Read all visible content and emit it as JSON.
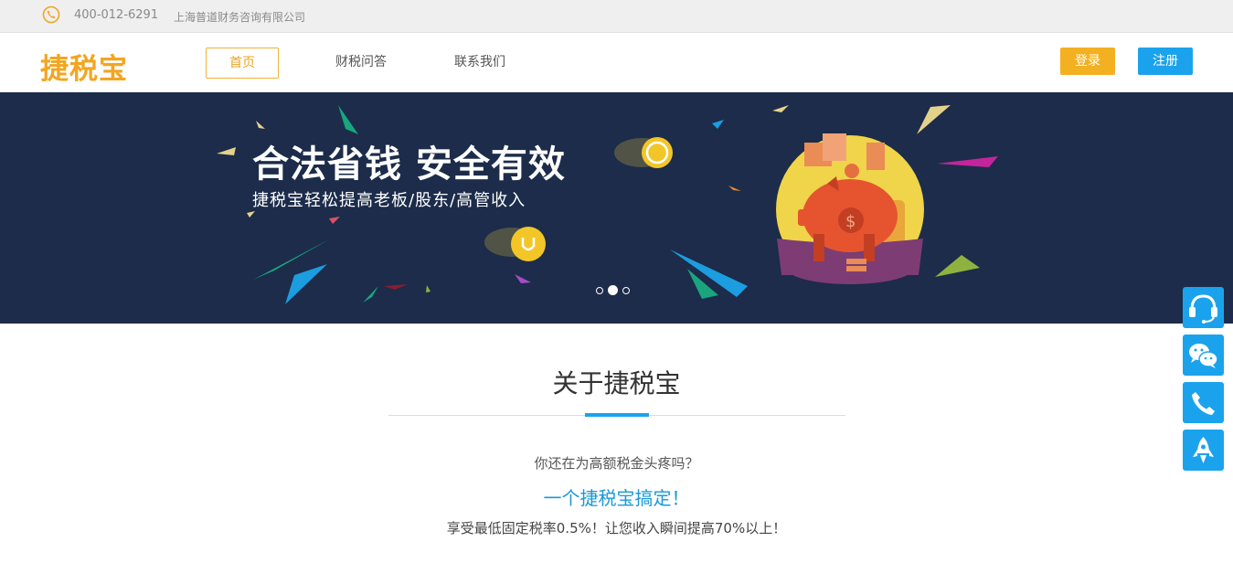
{
  "topbar": {
    "phone": "400-012-6291",
    "company": "上海普道财务咨询有限公司",
    "icon": "phone-circle-icon"
  },
  "header": {
    "logo": "捷税宝",
    "nav": [
      {
        "label": "首页",
        "active": true
      },
      {
        "label": "财税问答"
      },
      {
        "label": "联系我们"
      }
    ],
    "login": "登录",
    "register": "注册",
    "colors": {
      "brand": "#f3a521",
      "login": "#f3b020",
      "register": "#1aa3ec"
    }
  },
  "banner": {
    "headline": "合法省钱 安全有效",
    "subline": "捷税宝轻松提高老板/股东/高管收入",
    "background": "#1c2c4a",
    "slide_count": 3,
    "active_slide": 2
  },
  "about": {
    "title": "关于捷税宝",
    "q1": "你还在为高额税金头疼吗？",
    "q2": "一个捷税宝搞定！",
    "q3": "享受最低固定税率0.5%！让您收入瞬间提高70%以上！",
    "accent": "#1aa3ec"
  },
  "sidebar": [
    "headset-icon",
    "wechat-icon",
    "phone-icon",
    "rocket-icon"
  ]
}
